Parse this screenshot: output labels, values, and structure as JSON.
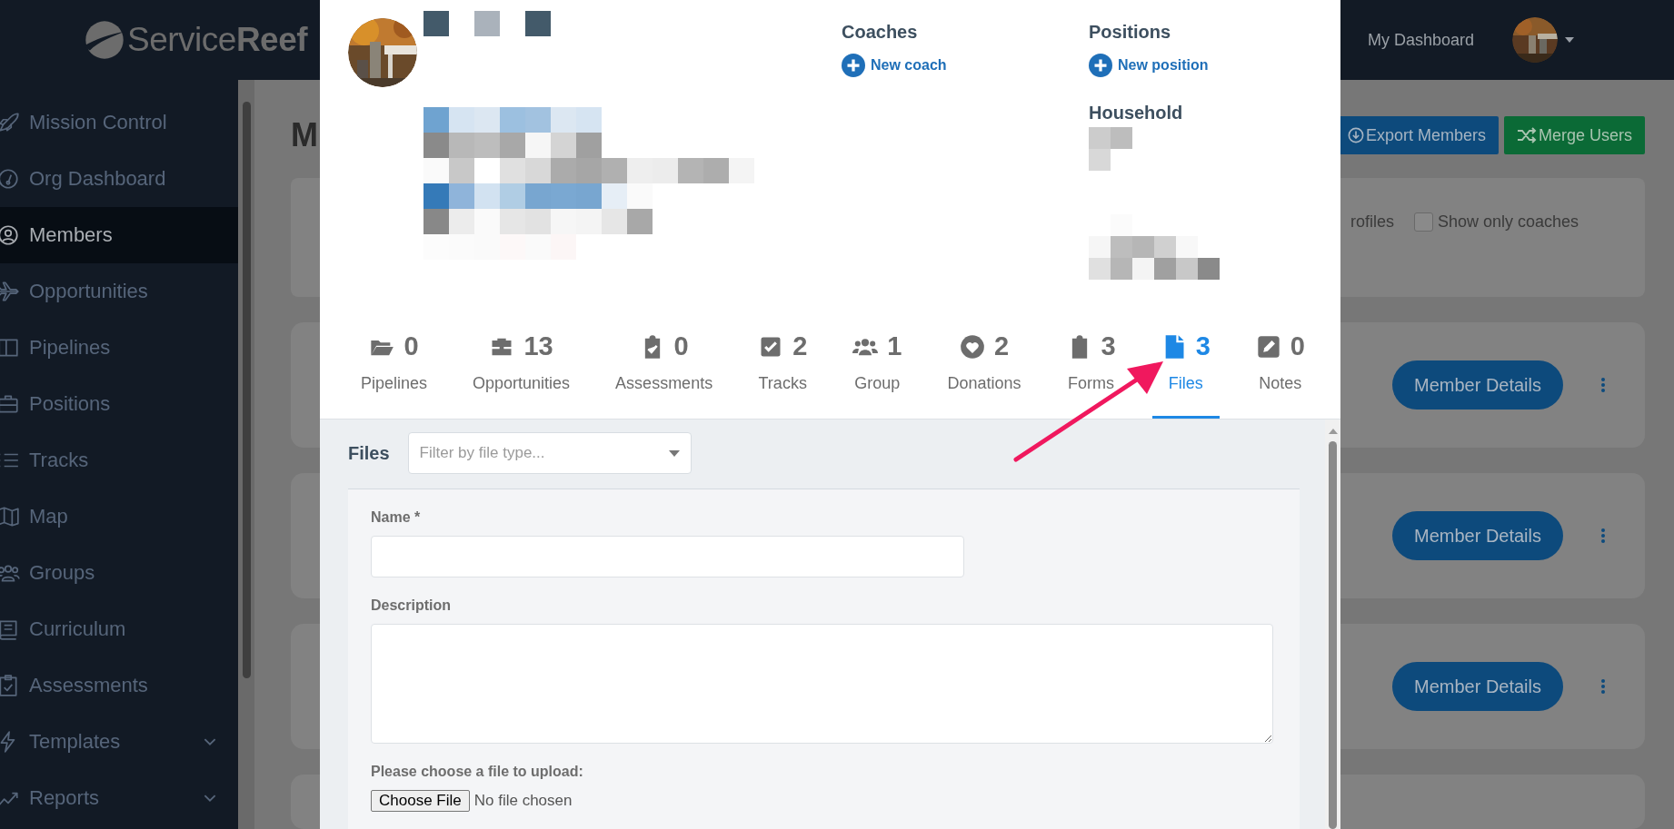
{
  "topbar": {
    "logo": "Service**Reef**",
    "dashboard_link": "My Dashboard"
  },
  "sidebar": {
    "items": [
      {
        "label": "Mission Control",
        "kind": "rocket",
        "selected": false,
        "expandable": false
      },
      {
        "label": "Org Dashboard",
        "kind": "gauge",
        "selected": false,
        "expandable": false
      },
      {
        "label": "Members",
        "kind": "user",
        "selected": true,
        "expandable": false
      },
      {
        "label": "Opportunities",
        "kind": "plane",
        "selected": false,
        "expandable": false
      },
      {
        "label": "Pipelines",
        "kind": "columns",
        "selected": false,
        "expandable": false
      },
      {
        "label": "Positions",
        "kind": "toolbox",
        "selected": false,
        "expandable": false
      },
      {
        "label": "Tracks",
        "kind": "list",
        "selected": false,
        "expandable": false
      },
      {
        "label": "Map",
        "kind": "map",
        "selected": false,
        "expandable": false
      },
      {
        "label": "Groups",
        "kind": "users",
        "selected": false,
        "expandable": false
      },
      {
        "label": "Curriculum",
        "kind": "book",
        "selected": false,
        "expandable": false
      },
      {
        "label": "Assessments",
        "kind": "clipboard",
        "selected": false,
        "expandable": false
      },
      {
        "label": "Templates",
        "kind": "bolt",
        "selected": false,
        "expandable": true
      },
      {
        "label": "Reports",
        "kind": "chart",
        "selected": false,
        "expandable": true
      }
    ]
  },
  "page": {
    "title": "M",
    "actions": [
      {
        "label": "Export Members",
        "kind": "export"
      },
      {
        "label": "Merge Users",
        "kind": "merge"
      }
    ],
    "filters": {
      "cut_label": "rofiles",
      "checkbox": {
        "label": "Show only coaches",
        "checked": false
      }
    },
    "member_cards": [
      {
        "button": "Member Details"
      },
      {
        "button": "Member Details"
      },
      {
        "button": "Member Details"
      }
    ]
  },
  "modal": {
    "coaches": {
      "heading": "Coaches",
      "add_label": "New coach"
    },
    "positions": {
      "heading": "Positions",
      "add_label": "New position"
    },
    "household": {
      "heading": "Household"
    },
    "stats": [
      {
        "kind": "folder",
        "count": "0",
        "label": "Pipelines",
        "selected": false
      },
      {
        "kind": "briefcase",
        "count": "13",
        "label": "Opportunities",
        "selected": false
      },
      {
        "kind": "clipboard-check",
        "count": "0",
        "label": "Assessments",
        "selected": false
      },
      {
        "kind": "check-square",
        "count": "2",
        "label": "Tracks",
        "selected": false
      },
      {
        "kind": "users",
        "count": "1",
        "label": "Group",
        "selected": false
      },
      {
        "kind": "heart",
        "count": "2",
        "label": "Donations",
        "selected": false
      },
      {
        "kind": "clipboard",
        "count": "3",
        "label": "Forms",
        "selected": false
      },
      {
        "kind": "file",
        "count": "3",
        "label": "Files",
        "selected": true
      },
      {
        "kind": "pencil",
        "count": "0",
        "label": "Notes",
        "selected": false
      }
    ],
    "files": {
      "heading": "Files",
      "filter_placeholder": "Filter by file type...",
      "name_label": "Name *",
      "description_label": "Description",
      "upload_label": "Please choose a file to upload:",
      "choose_button": "Choose File",
      "no_file": "No file chosen"
    }
  }
}
